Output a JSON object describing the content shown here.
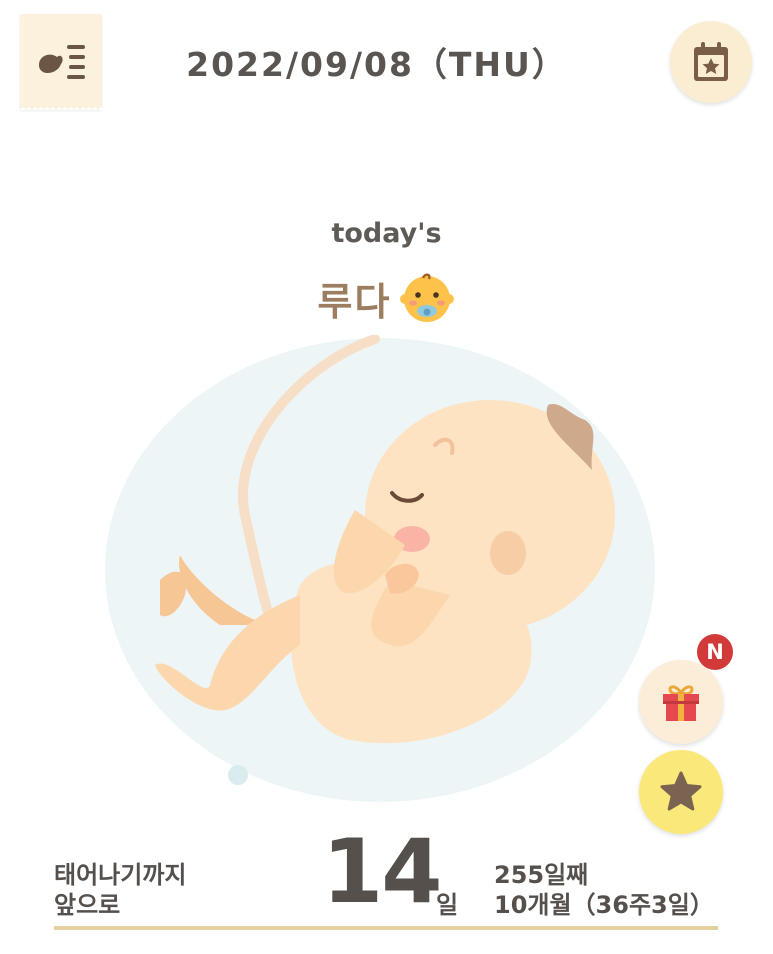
{
  "header": {
    "menu_icon": "baby-list-menu-icon",
    "date": "2022/09/08（THU）",
    "calendar_icon": "calendar-star-icon"
  },
  "main": {
    "todays_label": "today's",
    "baby_name": "루다",
    "baby_emoji": "baby-with-pacifier-icon",
    "illustration": "fetus-in-womb-illustration"
  },
  "side_buttons": {
    "gift_icon": "gift-icon",
    "new_badge": "N",
    "star_icon": "star-icon"
  },
  "countdown": {
    "label_line1": "태어나기까지",
    "label_line2": "앞으로",
    "days_left": "14",
    "days_unit": "일",
    "day_count": "255일째",
    "pregnancy_stage": "10개월（36주3일）"
  },
  "colors": {
    "accent_cream": "#fbf1dd",
    "name_brown": "#9c7d60",
    "star_yellow": "#fbe87a",
    "badge_red": "#d23a3a",
    "underline_gold": "#e4cf9f"
  }
}
